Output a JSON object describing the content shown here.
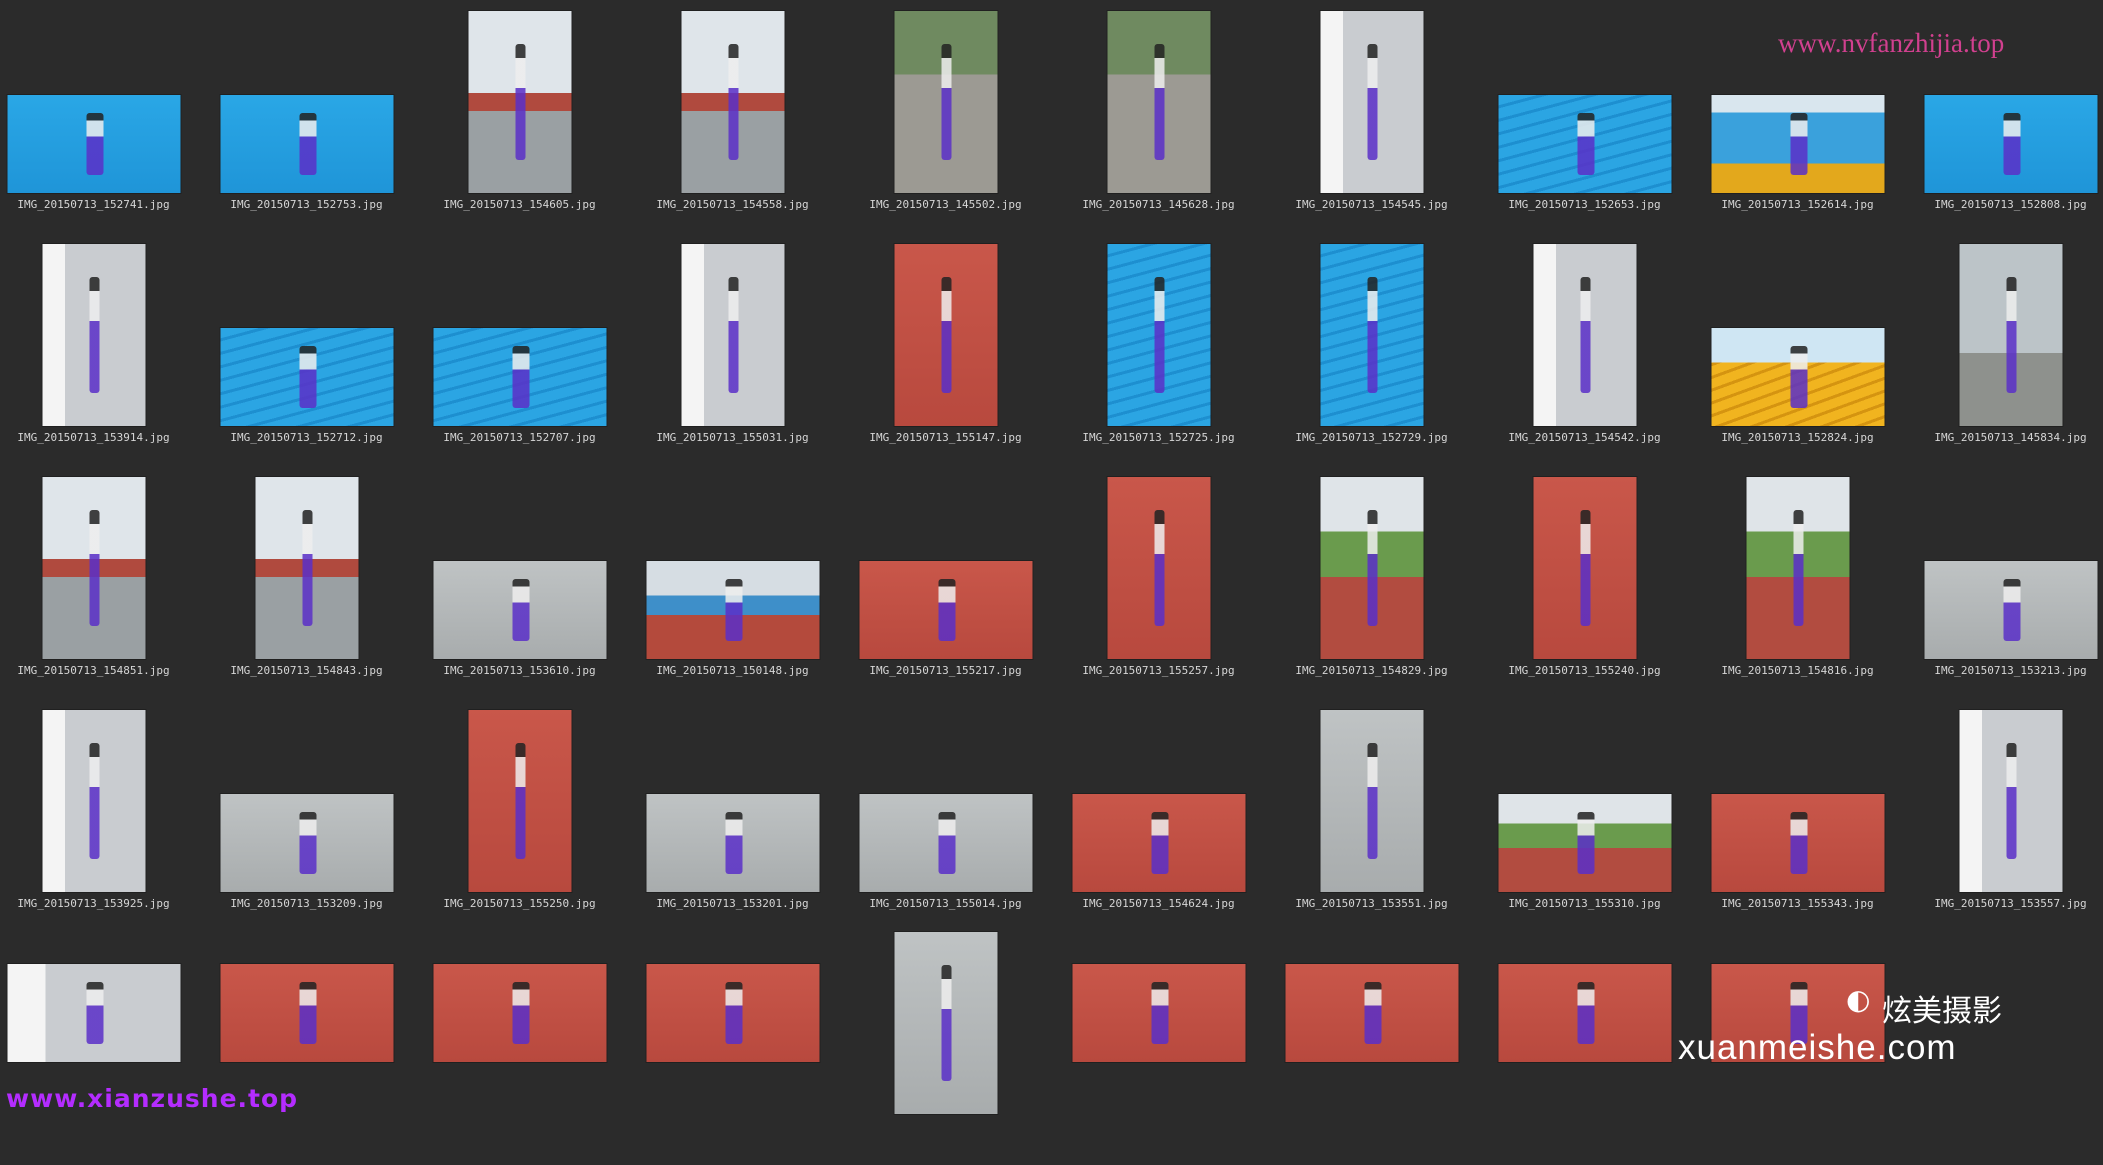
{
  "rows": [
    [
      {
        "file": "IMG_20150713_152741.jpg",
        "orient": "land",
        "scene": "floor-blue"
      },
      {
        "file": "IMG_20150713_152753.jpg",
        "orient": "land",
        "scene": "floor-blue"
      },
      {
        "file": "IMG_20150713_154605.jpg",
        "orient": "port",
        "scene": "railing"
      },
      {
        "file": "IMG_20150713_154558.jpg",
        "orient": "port",
        "scene": "railing"
      },
      {
        "file": "IMG_20150713_145502.jpg",
        "orient": "port",
        "scene": "street"
      },
      {
        "file": "IMG_20150713_145628.jpg",
        "orient": "port",
        "scene": "street"
      },
      {
        "file": "IMG_20150713_154545.jpg",
        "orient": "port",
        "scene": "corridor"
      },
      {
        "file": "IMG_20150713_152653.jpg",
        "orient": "land",
        "scene": "stairs-blue"
      },
      {
        "file": "IMG_20150713_152614.jpg",
        "orient": "land",
        "scene": "stand-sign"
      },
      {
        "file": "IMG_20150713_152808.jpg",
        "orient": "land",
        "scene": "floor-blue"
      }
    ],
    [
      {
        "file": "IMG_20150713_153914.jpg",
        "orient": "port",
        "scene": "corridor"
      },
      {
        "file": "IMG_20150713_152712.jpg",
        "orient": "land",
        "scene": "stairs-blue"
      },
      {
        "file": "IMG_20150713_152707.jpg",
        "orient": "land",
        "scene": "stairs-blue"
      },
      {
        "file": "IMG_20150713_155031.jpg",
        "orient": "port",
        "scene": "corridor"
      },
      {
        "file": "IMG_20150713_155147.jpg",
        "orient": "port",
        "scene": "track"
      },
      {
        "file": "IMG_20150713_152725.jpg",
        "orient": "port",
        "scene": "stairs-blue"
      },
      {
        "file": "IMG_20150713_152729.jpg",
        "orient": "port",
        "scene": "stairs-blue"
      },
      {
        "file": "IMG_20150713_154542.jpg",
        "orient": "port",
        "scene": "corridor"
      },
      {
        "file": "IMG_20150713_152824.jpg",
        "orient": "land",
        "scene": "stairs-yellow"
      },
      {
        "file": "IMG_20150713_145834.jpg",
        "orient": "port",
        "scene": "statue"
      }
    ],
    [
      {
        "file": "IMG_20150713_154851.jpg",
        "orient": "port",
        "scene": "railing"
      },
      {
        "file": "IMG_20150713_154843.jpg",
        "orient": "port",
        "scene": "railing"
      },
      {
        "file": "IMG_20150713_153610.jpg",
        "orient": "land",
        "scene": "floor-grey"
      },
      {
        "file": "IMG_20150713_150148.jpg",
        "orient": "land",
        "scene": "stadium"
      },
      {
        "file": "IMG_20150713_155217.jpg",
        "orient": "land",
        "scene": "track"
      },
      {
        "file": "IMG_20150713_155257.jpg",
        "orient": "port",
        "scene": "track"
      },
      {
        "file": "IMG_20150713_154829.jpg",
        "orient": "port",
        "scene": "field"
      },
      {
        "file": "IMG_20150713_155240.jpg",
        "orient": "port",
        "scene": "track"
      },
      {
        "file": "IMG_20150713_154816.jpg",
        "orient": "port",
        "scene": "field"
      },
      {
        "file": "IMG_20150713_153213.jpg",
        "orient": "land",
        "scene": "floor-grey"
      }
    ],
    [
      {
        "file": "IMG_20150713_153925.jpg",
        "orient": "port",
        "scene": "corridor"
      },
      {
        "file": "IMG_20150713_153209.jpg",
        "orient": "land",
        "scene": "floor-grey"
      },
      {
        "file": "IMG_20150713_155250.jpg",
        "orient": "port",
        "scene": "track"
      },
      {
        "file": "IMG_20150713_153201.jpg",
        "orient": "land",
        "scene": "floor-grey"
      },
      {
        "file": "IMG_20150713_155014.jpg",
        "orient": "land",
        "scene": "floor-grey"
      },
      {
        "file": "IMG_20150713_154624.jpg",
        "orient": "land",
        "scene": "track"
      },
      {
        "file": "IMG_20150713_153551.jpg",
        "orient": "port",
        "scene": "floor-grey"
      },
      {
        "file": "IMG_20150713_155310.jpg",
        "orient": "land",
        "scene": "field"
      },
      {
        "file": "IMG_20150713_155343.jpg",
        "orient": "land",
        "scene": "track"
      },
      {
        "file": "IMG_20150713_153557.jpg",
        "orient": "port",
        "scene": "corridor"
      }
    ],
    [
      {
        "file": "",
        "orient": "land",
        "scene": "corridor"
      },
      {
        "file": "",
        "orient": "land",
        "scene": "track"
      },
      {
        "file": "",
        "orient": "land",
        "scene": "track"
      },
      {
        "file": "",
        "orient": "land",
        "scene": "track"
      },
      {
        "file": "",
        "orient": "port",
        "scene": "floor-grey"
      },
      {
        "file": "",
        "orient": "land",
        "scene": "track"
      },
      {
        "file": "",
        "orient": "land",
        "scene": "track"
      },
      {
        "file": "",
        "orient": "land",
        "scene": "track"
      },
      {
        "file": "",
        "orient": "land",
        "scene": "track"
      },
      {
        "file": "",
        "orient": "none",
        "scene": "none"
      }
    ]
  ],
  "watermarks": {
    "top_right": "www.nvfanzhijia.top",
    "bottom_left": "www.xianzushe.top",
    "brand_cn": "炫美摄影",
    "brand_en": "xuanmeishe.com",
    "brand_logo_icon": "camera-mark-icon"
  },
  "colors": {
    "background": "#2b2b2b",
    "caption": "#d6d6d6",
    "watermark_top": "#d1408f",
    "watermark_bottom": "#b42cff"
  }
}
